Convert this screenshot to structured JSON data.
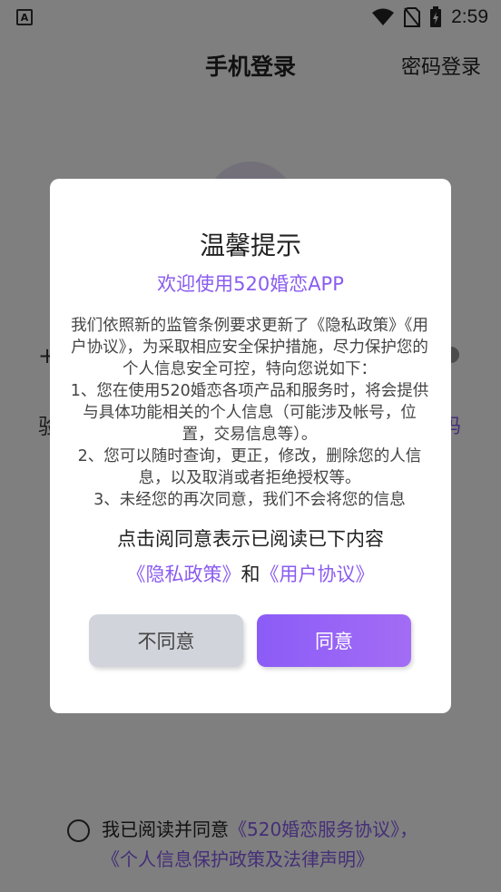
{
  "status_bar": {
    "app_icon_letter": "A",
    "time": "2:59"
  },
  "header": {
    "title": "手机登录",
    "password_login": "密码登录"
  },
  "background": {
    "plus_text": "+",
    "code_label": "验",
    "code_link": "码"
  },
  "agreement": {
    "prefix": "我已阅读并同意",
    "service_link": "《520婚恋服务协议》",
    "separator": "，",
    "privacy_link": "《个人信息保护政策及法律声明》"
  },
  "dialog": {
    "title": "温馨提示",
    "subtitle": "欢迎使用520婚恋APP",
    "body_intro": "我们依照新的监管条例要求更新了《隐私政策》《用户协议》，为采取相应安全保护措施，尽力保护您的个人信息安全可控，特向您说如下：",
    "item1": "1、您在使用520婚恋各项产品和服务时，将会提供与具体功能相关的个人信息（可能涉及帐号，位置，交易信息等）。",
    "item2": "2、您可以随时查询，更正，修改，删除您的人信息，以及取消或者拒绝授权等。",
    "item3": "3、未经您的再次同意，我们不会将您的信息",
    "confirm_text": "点击阅同意表示已阅读已下内容",
    "privacy_link": "《隐私政策》",
    "and_text": "和",
    "user_agreement_link": "《用户协议》",
    "disagree_label": "不同意",
    "agree_label": "同意"
  },
  "colors": {
    "accent": "#8a5cf0",
    "overlay": "rgba(0,0,0,0.5)",
    "disagree_bg": "#d1d5db"
  }
}
